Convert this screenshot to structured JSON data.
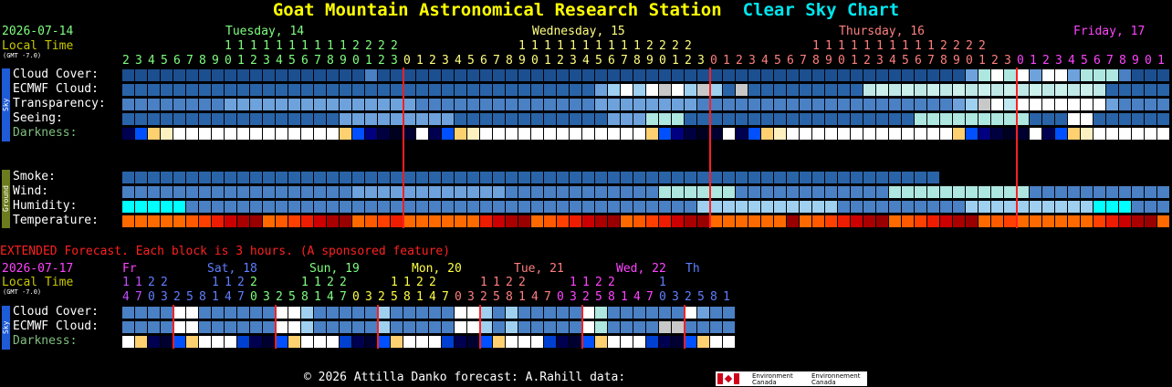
{
  "header": {
    "station": "Goat Mountain Astronomical Research Station",
    "chart_name": "Clear Sky Chart"
  },
  "top": {
    "date": "2026-07-14",
    "local_time_label": "Local Time",
    "gmt_label": "(GMT -7.0)",
    "days": [
      {
        "label": "Tuesday, 14",
        "color": "#7fff7f"
      },
      {
        "label": "Wednesday, 15",
        "color": "#ffff7f"
      },
      {
        "label": "Thursday, 16",
        "color": "#ff7f7f"
      },
      {
        "label": "Friday, 17",
        "color": "#ff44ff"
      }
    ],
    "hour_tens_rows": [
      "                1 1 1 1 1 1 1 1 1 1 2 2 2 2                   1 1 1 1 1 1 1 1 1 1 2 2 2 2                   1 1 1 1 1 1 1 1 1 1 2 2 2 2              1 1"
    ],
    "hour_units": "2 3 4 5 6 7 8 9 0 1 2 3 4 5 6 7 8 9 0 1 2 3 0 1 2 3 4 5 6 7 8 9 0 1 2 3 4 5 6 7 8 9 0 1 2 3 0 1 2 3 4 5 6 7 8 9 0 1 2 3 4 5 6 7 8 9 0 1 2 3 0 1 2 3 4 5 6 7 8 9 0 1",
    "sky_sidebar": "Sky",
    "ground_sidebar": "Ground",
    "rows": [
      {
        "label": "Cloud Cover:",
        "key": "cloud"
      },
      {
        "label": "ECMWF Cloud:",
        "key": "ecmwf"
      },
      {
        "label": "Transparency:",
        "key": "transp"
      },
      {
        "label": "Seeing:",
        "key": "seeing"
      },
      {
        "label": "Darkness:",
        "key": "dark"
      }
    ],
    "ground_rows": [
      {
        "label": "Smoke:",
        "key": "smoke"
      },
      {
        "label": "Wind:",
        "key": "wind"
      },
      {
        "label": "Humidity:",
        "key": "humid"
      },
      {
        "label": "Temperature:",
        "key": "temp"
      }
    ]
  },
  "extended": {
    "note": "EXTENDED Forecast. Each block is 3 hours. (A sponsored feature)",
    "date": "2026-07-17",
    "local_time_label": "Local Time",
    "gmt_label": "(GMT -7.0)",
    "days": [
      {
        "label": "Fr",
        "color": "#ff44ff"
      },
      {
        "label": "Sat, 18",
        "color": "#5f7fff"
      },
      {
        "label": "Sun, 19",
        "color": "#7fff7f"
      },
      {
        "label": "Mon, 20",
        "color": "#ffff44"
      },
      {
        "label": "Tue, 21",
        "color": "#ff7f7f"
      },
      {
        "label": "Wed, 22",
        "color": "#ff44ff"
      },
      {
        "label": "Th",
        "color": "#5f7fff"
      }
    ],
    "tens": "1 1 2 2       1 1 2 2       1 1 2 2       1 1 2 2       1 1 2 2       1 1 2 2       1",
    "units": "4 7 0 3 2 5 8 1 4 7 0 3 2 5 8 1 4 7 0 3 2 5 8 1 4 7 0 3 2 5 8 1 4 7 0 3 2 5 8 1 4 7 0 3 2 5 8 1",
    "rows": [
      {
        "label": "Cloud Cover:"
      },
      {
        "label": "ECMWF Cloud:"
      },
      {
        "label": "Darkness:"
      }
    ]
  },
  "footer": {
    "text": "© 2026 Attilla Danko  forecast: A.Rahill  data:",
    "ec_en": "Environment Canada",
    "ec_fr": "Environnement Canada"
  },
  "colors": {
    "accent_title": "#ffff00",
    "accent_chart": "#00e5ee",
    "red_line": "#ff2020"
  }
}
